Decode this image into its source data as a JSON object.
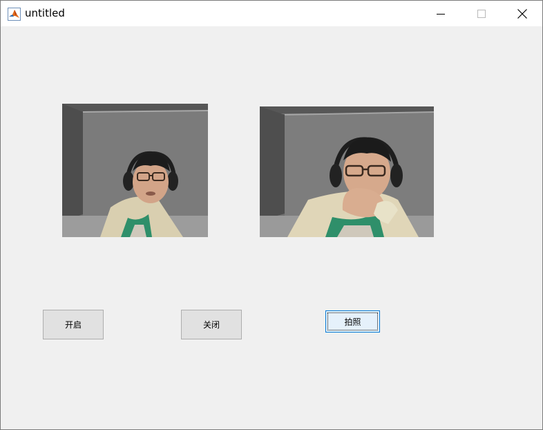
{
  "window": {
    "title": "untitled",
    "app_icon": "matlab-icon",
    "controls": [
      "minimize-icon",
      "maximize-icon",
      "close-icon"
    ]
  },
  "axes": [
    {
      "name": "live-preview",
      "content": "webcam video frame of a person wearing glasses and headphones"
    },
    {
      "name": "captured-photo",
      "content": "snapshot of a person wearing glasses and headphones, hand on chin"
    }
  ],
  "buttons": {
    "open_label": "开启",
    "close_label": "关闭",
    "photo_label": "拍照"
  },
  "colors": {
    "window_bg": "#f0f0f0",
    "button_bg": "#e1e1e1",
    "focused_button_bg": "#e5f1fb",
    "focus_border": "#0078d7"
  }
}
